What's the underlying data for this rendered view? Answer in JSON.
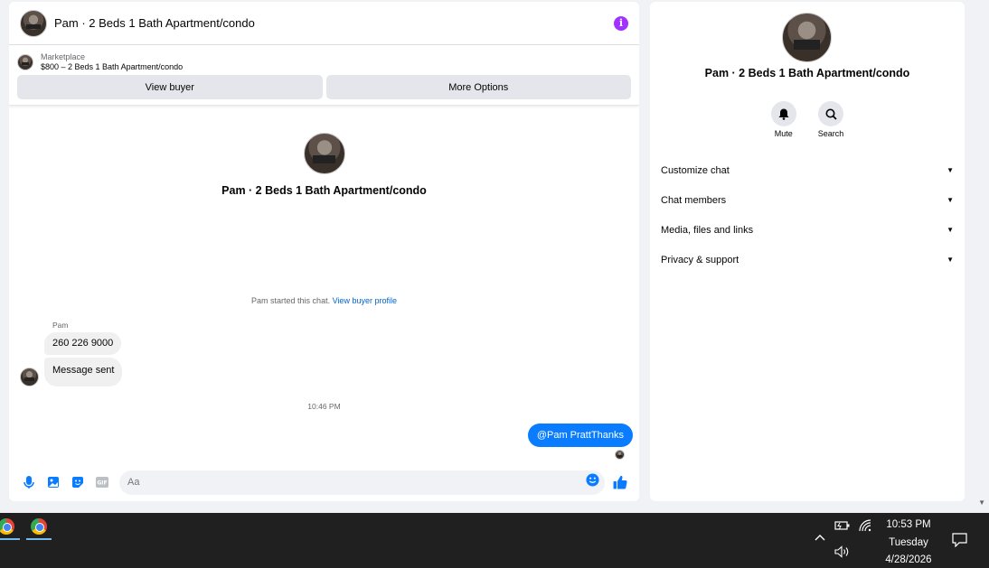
{
  "chat": {
    "header_title": "Pam · 2 Beds 1 Bath Apartment/condo",
    "marketplace": {
      "label": "Marketplace",
      "listing": "$800 – 2 Beds 1 Bath Apartment/condo",
      "view_buyer": "View buyer",
      "more_options": "More Options"
    },
    "intro_name": "Pam · 2 Beds 1 Bath Apartment/condo",
    "system_message": "Pam started this chat.",
    "system_link": "View buyer profile",
    "sender_name": "Pam",
    "messages_in": [
      "260 226 9000",
      "Message sent"
    ],
    "timestamp": "10:46 PM",
    "message_out_mention": "@Pam Pratt",
    "message_out_text": "Thanks",
    "composer_placeholder": "Aa"
  },
  "side": {
    "name": "Pam · 2 Beds 1 Bath Apartment/condo",
    "actions": {
      "mute": "Mute",
      "search": "Search"
    },
    "menu": [
      "Customize chat",
      "Chat members",
      "Media, files and links",
      "Privacy & support"
    ]
  },
  "taskbar": {
    "time": "10:53 PM",
    "day": "Tuesday",
    "date": "4/28/2026"
  },
  "colors": {
    "accent_blue": "#0a7cff",
    "info_purple": "#a033ff",
    "link_blue": "#0064d1"
  }
}
